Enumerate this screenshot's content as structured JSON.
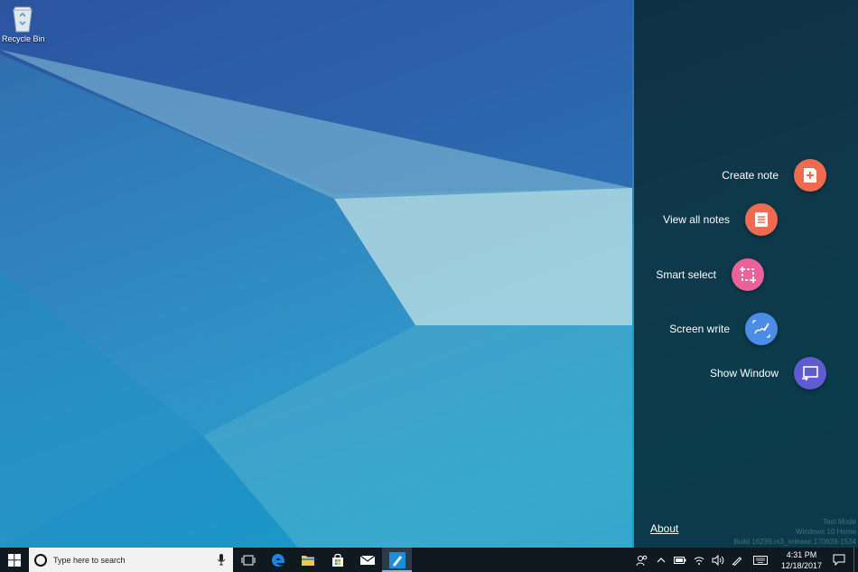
{
  "desktop": {
    "icons": [
      {
        "label": "Recycle Bin",
        "icon": "recycle-bin-icon"
      }
    ]
  },
  "air_command": {
    "items": [
      {
        "label": "Create note",
        "icon": "create-note-icon",
        "color": "#ee6b50"
      },
      {
        "label": "View all notes",
        "icon": "notes-list-icon",
        "color": "#ee6b50"
      },
      {
        "label": "Smart select",
        "icon": "smart-select-icon",
        "color": "#e9629a"
      },
      {
        "label": "Screen write",
        "icon": "screen-write-icon",
        "color": "#4a8ce6"
      },
      {
        "label": "Show Window",
        "icon": "show-window-icon",
        "color": "#5f5cd2"
      }
    ],
    "about_label": "About",
    "watermark": [
      "Test Mode",
      "Windows 10 Home",
      "Build 16299.rs3_release.170928-1534"
    ]
  },
  "taskbar": {
    "search_placeholder": "Type here to search",
    "apps": [
      {
        "name": "task-view",
        "icon": "task-view-icon"
      },
      {
        "name": "edge",
        "icon": "edge-icon",
        "color": "#1e86e0"
      },
      {
        "name": "file-explorer",
        "icon": "folder-icon",
        "color": "#f3c44e"
      },
      {
        "name": "store",
        "icon": "store-icon"
      },
      {
        "name": "mail",
        "icon": "mail-icon"
      },
      {
        "name": "samsung-notes",
        "icon": "pen-app-icon",
        "color": "#1a8fd8"
      }
    ],
    "clock": {
      "time": "4:31 PM",
      "date": "12/18/2017"
    }
  }
}
